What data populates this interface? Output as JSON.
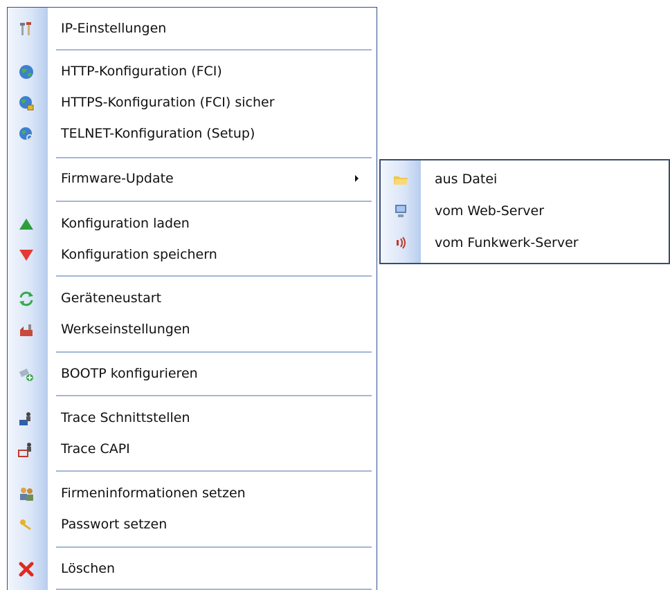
{
  "main_menu": {
    "items": {
      "ip_settings": {
        "label": "IP-Einstellungen",
        "icon": "tools-icon"
      },
      "http_config": {
        "label": "HTTP-Konfiguration (FCI)",
        "icon": "globe-icon"
      },
      "https_config": {
        "label": "HTTPS-Konfiguration (FCI) sicher",
        "icon": "globe-lock-icon"
      },
      "telnet_config": {
        "label": "TELNET-Konfiguration (Setup)",
        "icon": "globe-search-icon"
      },
      "firmware_update": {
        "label": "Firmware-Update",
        "has_submenu": true
      },
      "load_config": {
        "label": "Konfiguration laden",
        "icon": "up-triangle-icon"
      },
      "save_config": {
        "label": "Konfiguration speichern",
        "icon": "down-triangle-icon"
      },
      "device_restart": {
        "label": "Geräteneustart",
        "icon": "refresh-icon"
      },
      "factory_reset": {
        "label": "Werkseinstellungen",
        "icon": "factory-icon"
      },
      "bootp": {
        "label": "BOOTP konfigurieren",
        "icon": "bootp-icon"
      },
      "trace_interfaces": {
        "label": "Trace Schnittstellen",
        "icon": "trace-icon"
      },
      "trace_capi": {
        "label": "Trace CAPI",
        "icon": "trace-capi-icon"
      },
      "company_info": {
        "label": "Firmeninformationen setzen",
        "icon": "users-icon"
      },
      "set_password": {
        "label": "Passwort setzen",
        "icon": "key-icon"
      },
      "delete": {
        "label": "Löschen",
        "icon": "delete-icon"
      }
    }
  },
  "submenu": {
    "items": {
      "from_file": {
        "label": "aus Datei",
        "icon": "folder-icon"
      },
      "from_web_server": {
        "label": "vom Web-Server",
        "icon": "computer-icon"
      },
      "from_funkwerk_server": {
        "label": "vom Funkwerk-Server",
        "icon": "signal-icon"
      }
    }
  },
  "colors": {
    "menu_border": "#2b4e8f",
    "separator": "#a3b6d6",
    "gutter_light": "#f2f6fd",
    "gutter_dark": "#b8cdee",
    "submenu_border": "#3a4c6b"
  }
}
